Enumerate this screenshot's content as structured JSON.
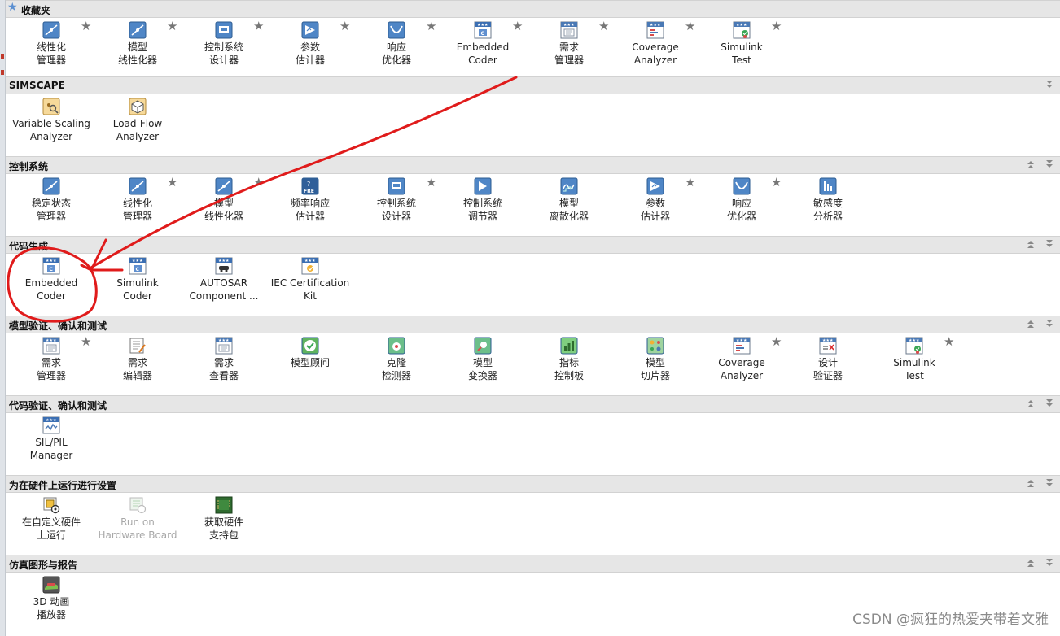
{
  "sections": [
    {
      "id": "favorites",
      "title": "收藏夹",
      "collapse": false,
      "tiles": [
        {
          "label": "线性化\n管理器",
          "icon": "linearization-manager-icon",
          "star": true
        },
        {
          "label": "模型\n线性化器",
          "icon": "model-linearizer-icon",
          "star": true
        },
        {
          "label": "控制系统\n设计器",
          "icon": "control-system-designer-icon",
          "star": true
        },
        {
          "label": "参数\n估计器",
          "icon": "parameter-estimator-icon",
          "star": true
        },
        {
          "label": "响应\n优化器",
          "icon": "response-optimizer-icon",
          "star": true
        },
        {
          "label": "Embedded\nCoder",
          "icon": "embedded-coder-icon",
          "star": true
        },
        {
          "label": "需求\n管理器",
          "icon": "requirements-manager-icon",
          "star": true
        },
        {
          "label": "Coverage\nAnalyzer",
          "icon": "coverage-analyzer-icon",
          "star": true
        },
        {
          "label": "Simulink\nTest",
          "icon": "simulink-test-icon",
          "star": true
        }
      ]
    },
    {
      "id": "simscape",
      "title": "SIMSCAPE",
      "collapse": "down",
      "tiles": [
        {
          "label": "Variable Scaling\nAnalyzer",
          "icon": "variable-scaling-analyzer-icon",
          "star": false
        },
        {
          "label": "Load-Flow\nAnalyzer",
          "icon": "load-flow-analyzer-icon",
          "star": false
        }
      ]
    },
    {
      "id": "control",
      "title": "控制系统",
      "collapse": "both",
      "tiles": [
        {
          "label": "稳定状态\n管理器",
          "icon": "steady-state-manager-icon",
          "star": false
        },
        {
          "label": "线性化\n管理器",
          "icon": "linearization-manager-icon",
          "star": true
        },
        {
          "label": "模型\n线性化器",
          "icon": "model-linearizer-icon",
          "star": true
        },
        {
          "label": "频率响应\n估计器",
          "icon": "frequency-response-estimator-icon",
          "star": false
        },
        {
          "label": "控制系统\n设计器",
          "icon": "control-system-designer-icon",
          "star": true
        },
        {
          "label": "控制系统\n调节器",
          "icon": "control-system-tuner-icon",
          "star": false
        },
        {
          "label": "模型\n离散化器",
          "icon": "model-discretizer-icon",
          "star": false
        },
        {
          "label": "参数\n估计器",
          "icon": "parameter-estimator-icon",
          "star": true
        },
        {
          "label": "响应\n优化器",
          "icon": "response-optimizer-icon",
          "star": true
        },
        {
          "label": "敏感度\n分析器",
          "icon": "sensitivity-analyzer-icon",
          "star": false
        }
      ]
    },
    {
      "id": "codegen",
      "title": "代码生成",
      "collapse": "both",
      "tiles": [
        {
          "label": "Embedded\nCoder",
          "icon": "embedded-coder-icon",
          "star": false
        },
        {
          "label": "Simulink\nCoder",
          "icon": "simulink-coder-icon",
          "star": false
        },
        {
          "label": "AUTOSAR\nComponent ...",
          "icon": "autosar-component-icon",
          "star": false
        },
        {
          "label": "IEC Certification\nKit",
          "icon": "iec-certification-kit-icon",
          "star": false
        }
      ]
    },
    {
      "id": "model-verify",
      "title": "模型验证、确认和测试",
      "collapse": "both",
      "tiles": [
        {
          "label": "需求\n管理器",
          "icon": "requirements-manager-icon",
          "star": true
        },
        {
          "label": "需求\n编辑器",
          "icon": "requirements-editor-icon",
          "star": false
        },
        {
          "label": "需求\n查看器",
          "icon": "requirements-viewer-icon",
          "star": false
        },
        {
          "label": "模型顾问",
          "icon": "model-advisor-icon",
          "star": false
        },
        {
          "label": "克隆\n检测器",
          "icon": "clone-detector-icon",
          "star": false
        },
        {
          "label": "模型\n变换器",
          "icon": "model-transformer-icon",
          "star": false
        },
        {
          "label": "指标\n控制板",
          "icon": "metrics-dashboard-icon",
          "star": false
        },
        {
          "label": "模型\n切片器",
          "icon": "model-slicer-icon",
          "star": false
        },
        {
          "label": "Coverage\nAnalyzer",
          "icon": "coverage-analyzer-icon",
          "star": true
        },
        {
          "label": "设计\n验证器",
          "icon": "design-verifier-icon",
          "star": false
        },
        {
          "label": "Simulink\nTest",
          "icon": "simulink-test-icon",
          "star": true
        }
      ]
    },
    {
      "id": "code-verify",
      "title": "代码验证、确认和测试",
      "collapse": "both",
      "tiles": [
        {
          "label": "SIL/PIL\nManager",
          "icon": "sil-pil-manager-icon",
          "star": false
        }
      ]
    },
    {
      "id": "hardware",
      "title": "为在硬件上运行进行设置",
      "collapse": "both",
      "tiles": [
        {
          "label": "在自定义硬件\n上运行",
          "icon": "run-on-custom-hardware-icon",
          "star": false
        },
        {
          "label": "Run on\nHardware Board",
          "icon": "run-on-hardware-board-icon",
          "star": false,
          "disabled": true
        },
        {
          "label": "获取硬件\n支持包",
          "icon": "get-hardware-support-icon",
          "star": false
        }
      ]
    },
    {
      "id": "sim-graphics",
      "title": "仿真图形与报告",
      "collapse": "both",
      "tiles": [
        {
          "label": "3D 动画\n播放器",
          "icon": "3d-animation-player-icon",
          "star": false
        }
      ]
    }
  ],
  "colors": {
    "header_bg": "#e6e6e6",
    "annotation_red": "#e01b1b",
    "star": "#777777"
  },
  "watermark": "CSDN @疯狂的热爱夹带着文雅"
}
